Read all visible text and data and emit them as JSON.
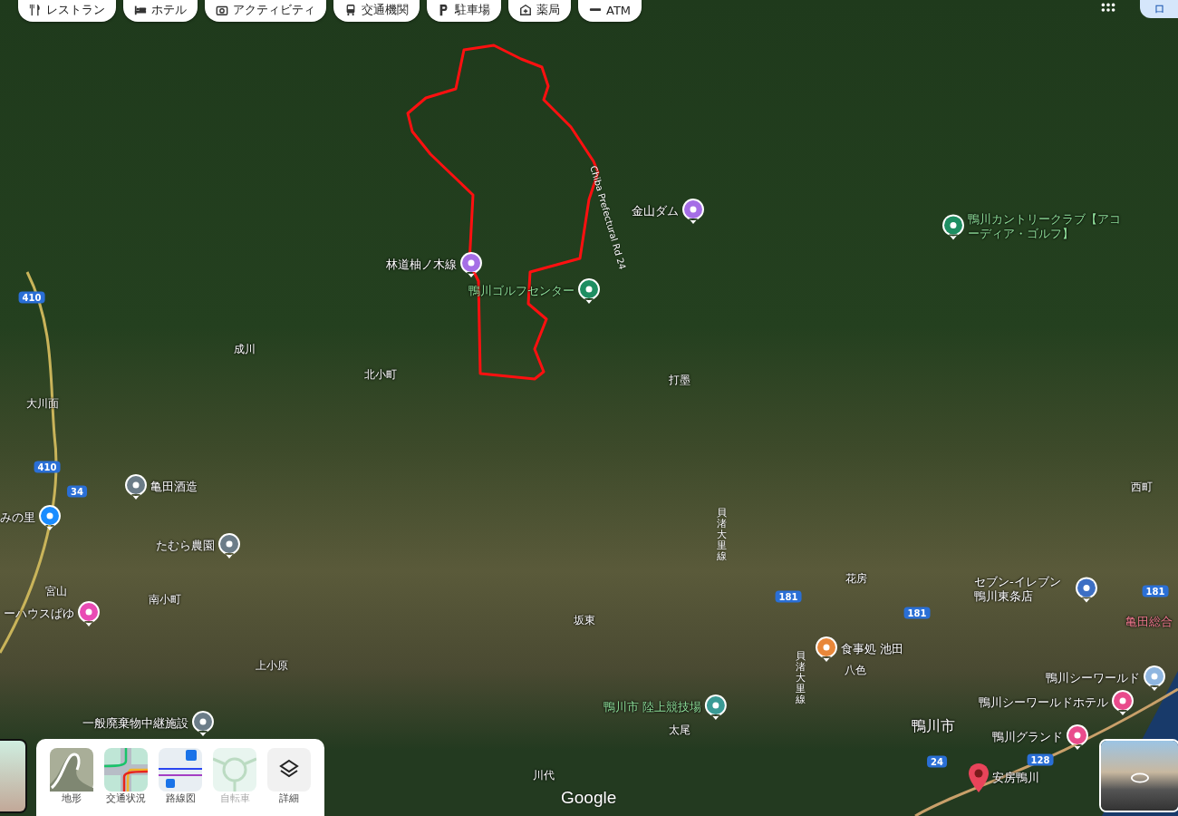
{
  "category_chips": [
    {
      "kind": "restaurant",
      "label": "レストラン"
    },
    {
      "kind": "hotel",
      "label": "ホテル"
    },
    {
      "kind": "activity",
      "label": "アクティビティ"
    },
    {
      "kind": "transit",
      "label": "交通機関"
    },
    {
      "kind": "parking",
      "label": "駐車場"
    },
    {
      "kind": "pharmacy",
      "label": "薬局"
    },
    {
      "kind": "atm",
      "label": "ATM"
    }
  ],
  "account_button": "ロ",
  "map_labels": [
    {
      "kind": "poi",
      "text": "林道柚ノ木線",
      "color": "#a56ee6"
    },
    {
      "kind": "poi",
      "text": "金山ダム",
      "color": "#a56ee6"
    },
    {
      "kind": "road-name",
      "text": "Chiba Prefectural Rd 24"
    },
    {
      "kind": "park-poi",
      "text": "鴨川カントリークラブ【アコーディア・ゴルフ】",
      "color": "#1e8e62"
    },
    {
      "kind": "park-poi",
      "text": "鴨川ゴルフセンター",
      "color": "#1e8e62"
    },
    {
      "kind": "road-shield",
      "text": "410"
    },
    {
      "kind": "place",
      "text": "成川"
    },
    {
      "kind": "place",
      "text": "北小町"
    },
    {
      "kind": "place",
      "text": "打墨"
    },
    {
      "kind": "place",
      "text": "大川面"
    },
    {
      "kind": "road-shield",
      "text": "410"
    },
    {
      "kind": "road-shield",
      "text": "34"
    },
    {
      "kind": "poi",
      "text": "亀田酒造",
      "color": "#6b7c88"
    },
    {
      "kind": "place",
      "text": "西町"
    },
    {
      "kind": "poi",
      "text": "みの里",
      "color": "#1a8cff"
    },
    {
      "kind": "vertical-road-name",
      "text": "貝渚大里線"
    },
    {
      "kind": "poi",
      "text": "たむら農園",
      "color": "#6b7c88"
    },
    {
      "kind": "place",
      "text": "宮山"
    },
    {
      "kind": "place",
      "text": "南小町"
    },
    {
      "kind": "road-shield",
      "text": "181"
    },
    {
      "kind": "place",
      "text": "花房"
    },
    {
      "kind": "poi",
      "text": "セブン-イレブン鴨川東条店",
      "color": "#3d6fc4"
    },
    {
      "kind": "road-shield",
      "text": "181"
    },
    {
      "kind": "poi",
      "text": "ーハウスぱゆ",
      "color": "#e94bb4"
    },
    {
      "kind": "place",
      "text": "坂東"
    },
    {
      "kind": "road-shield",
      "text": "181"
    },
    {
      "kind": "medical-name",
      "text": "亀田総合"
    },
    {
      "kind": "poi",
      "text": "食事処 池田",
      "color": "#e8873a"
    },
    {
      "kind": "place",
      "text": "上小原"
    },
    {
      "kind": "vertical-road-name",
      "text": "貝渚大里線"
    },
    {
      "kind": "place",
      "text": "八色"
    },
    {
      "kind": "poi",
      "text": "鴨川シーワールド",
      "color": "#8fb6e0"
    },
    {
      "kind": "park-poi",
      "text": "鴨川市 陸上競技場",
      "color": "#3a9a95"
    },
    {
      "kind": "poi",
      "text": "鴨川シーワールドホテル",
      "color": "#e94b8c"
    },
    {
      "kind": "poi",
      "text": "一般廃棄物中継施設",
      "color": "#6b7c88"
    },
    {
      "kind": "place",
      "text": "太尾"
    },
    {
      "kind": "city",
      "text": "鴨川市"
    },
    {
      "kind": "poi",
      "text": "鴨川グランド",
      "color": "#e94b8c"
    },
    {
      "kind": "road-shield",
      "text": "24"
    },
    {
      "kind": "road-shield",
      "text": "128"
    },
    {
      "kind": "place",
      "text": "川代"
    },
    {
      "kind": "search-pin",
      "text": "安房鴨川",
      "color": "#e8445a"
    }
  ],
  "logo": "Google",
  "layers": [
    {
      "kind": "terrain",
      "label": "地形",
      "disabled": false
    },
    {
      "kind": "traffic",
      "label": "交通状況",
      "disabled": false
    },
    {
      "kind": "transit",
      "label": "路線図",
      "disabled": false
    },
    {
      "kind": "bicycle",
      "label": "自転車",
      "disabled": true
    },
    {
      "kind": "more",
      "label": "詳細",
      "disabled": false
    }
  ]
}
